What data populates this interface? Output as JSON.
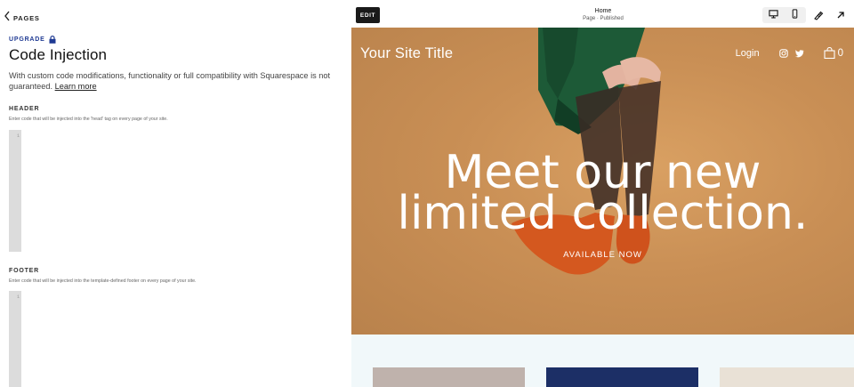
{
  "sidebar": {
    "back_label": "PAGES",
    "upgrade_label": "UPGRADE",
    "title": "Code Injection",
    "description": "With custom code modifications, functionality or full compatibility with Squarespace is not guaranteed.",
    "learn_more": "Learn more",
    "header_section": {
      "label": "HEADER",
      "help": "Enter code that will be injected into the 'head' tag on every page of your site.",
      "line_number": "1"
    },
    "footer_section": {
      "label": "FOOTER",
      "help": "Enter code that will be injected into the template-defined footer on every page of your site.",
      "line_number": "1"
    }
  },
  "toolbar": {
    "edit_label": "EDIT",
    "page_name": "Home",
    "page_status": "Page · Published",
    "icons": [
      "desktop-icon",
      "mobile-icon",
      "style-brush-icon",
      "open-external-icon"
    ]
  },
  "site": {
    "title": "Your Site Title",
    "login": "Login",
    "social_icons": [
      "instagram-icon",
      "twitter-icon"
    ],
    "cart_count": "0",
    "headline_line1": "Meet our new",
    "headline_line2": "limited collection.",
    "cta": "AVAILABLE NOW"
  },
  "colors": {
    "hero_background": "#c98f55",
    "dress_green": "#1f5e3a",
    "shoe_orange": "#d2561f",
    "lower_section": "#f1f8fa",
    "upgrade_blue": "#1f3a93"
  }
}
